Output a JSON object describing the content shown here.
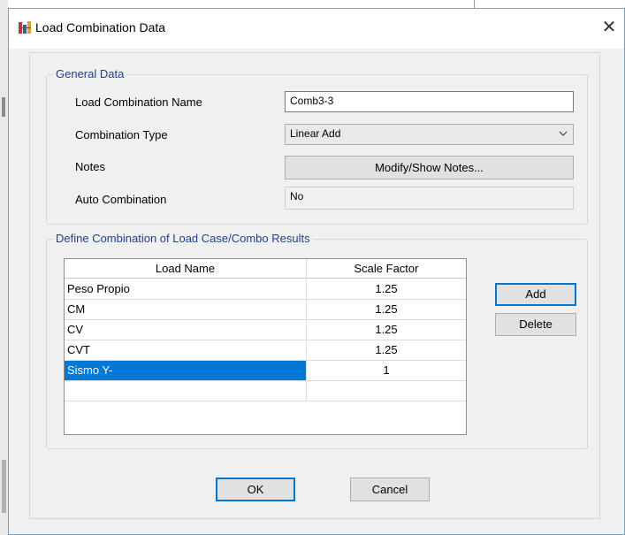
{
  "window": {
    "title": "Load Combination Data",
    "close_glyph": "✕"
  },
  "general": {
    "legend": "General Data",
    "name_label": "Load Combination Name",
    "name_value": "Comb3-3",
    "type_label": "Combination Type",
    "type_value": "Linear Add",
    "notes_label": "Notes",
    "notes_button": "Modify/Show Notes...",
    "auto_label": "Auto Combination",
    "auto_value": "No"
  },
  "define": {
    "legend": "Define Combination of Load Case/Combo Results",
    "columns": [
      "Load Name",
      "Scale Factor"
    ],
    "rows": [
      {
        "name": "Peso Propio",
        "factor": "1.25"
      },
      {
        "name": "CM",
        "factor": "1.25"
      },
      {
        "name": "CV",
        "factor": "1.25"
      },
      {
        "name": "CVT",
        "factor": "1.25"
      },
      {
        "name": "Sismo Y-",
        "factor": "1"
      }
    ],
    "selected_row": 4,
    "add_button": "Add",
    "delete_button": "Delete"
  },
  "footer": {
    "ok_button": "OK",
    "cancel_button": "Cancel"
  },
  "icons": {
    "app": "etabs-load-icon",
    "dropdown": "chevron-down-icon"
  },
  "colors": {
    "selection": "#0078d7",
    "legend_text": "#1f3f8e"
  }
}
